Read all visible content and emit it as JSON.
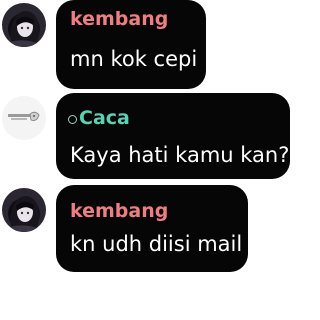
{
  "messages": [
    {
      "sender": "kembang",
      "text": "mn kok cepi",
      "name_color": "#ec7f84",
      "avatar": "anime-girl-dark-avatar"
    },
    {
      "sender": "Caca",
      "text": "Kaya hati kamu kan?",
      "name_color": "#5cd0b2",
      "avatar": "white-sketch-avatar"
    },
    {
      "sender": "kembang",
      "text": "kn udh diisi mail",
      "name_color": "#ec7f84",
      "avatar": "anime-girl-dark-avatar"
    }
  ]
}
